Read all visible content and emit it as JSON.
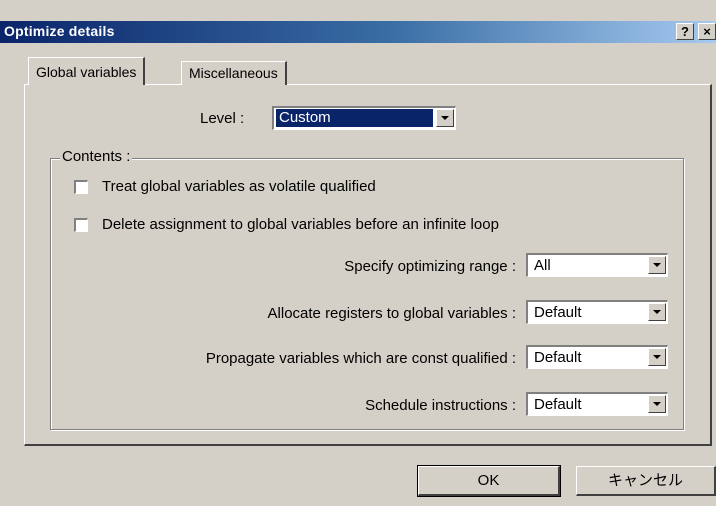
{
  "window": {
    "title": "Optimize details",
    "help_glyph": "?",
    "close_glyph": "×"
  },
  "tabs": [
    {
      "label": "Global variables",
      "active": true
    },
    {
      "label": "Miscellaneous",
      "active": false
    }
  ],
  "level": {
    "label": "Level :",
    "value": "Custom"
  },
  "contents": {
    "group_label": "Contents :",
    "checkboxes": [
      {
        "label": "Treat global variables as volatile qualified",
        "checked": false
      },
      {
        "label": "Delete assignment to global variables before an infinite loop",
        "checked": false
      }
    ],
    "options": [
      {
        "label": "Specify optimizing range :",
        "value": "All"
      },
      {
        "label": "Allocate registers to global variables :",
        "value": "Default"
      },
      {
        "label": "Propagate variables which are const qualified :",
        "value": "Default"
      },
      {
        "label": "Schedule instructions :",
        "value": "Default"
      }
    ]
  },
  "buttons": {
    "ok_label": "OK",
    "cancel_label": "キャンセル"
  }
}
